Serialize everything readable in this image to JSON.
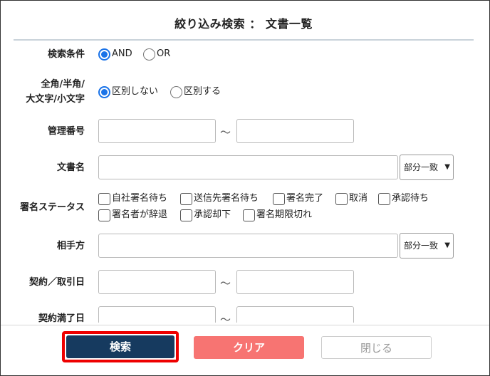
{
  "header": {
    "title": "絞り込み検索 ： 文書一覧"
  },
  "form": {
    "search_condition": {
      "label": "検索条件",
      "options": [
        "AND",
        "OR"
      ],
      "selected": "AND"
    },
    "width_case": {
      "label_line1": "全角/半角/",
      "label_line2": "大文字/小文字",
      "options": [
        "区別しない",
        "区別する"
      ],
      "selected": "区別しない"
    },
    "management_number": {
      "label": "管理番号",
      "separator": "～",
      "from_value": "",
      "to_value": ""
    },
    "document_name": {
      "label": "文書名",
      "value": "",
      "match": "部分一致"
    },
    "signature_status": {
      "label": "署名ステータス",
      "options": [
        "自社署名待ち",
        "送信先署名待ち",
        "署名完了",
        "取消",
        "承認待ち",
        "署名者が辞退",
        "承認却下",
        "署名期限切れ"
      ]
    },
    "counterparty": {
      "label": "相手方",
      "value": "",
      "match": "部分一致"
    },
    "contract_date": {
      "label": "契約／取引日",
      "separator": "～"
    },
    "contract_end_date": {
      "label": "契約満了日",
      "separator": "～"
    }
  },
  "footer": {
    "search_label": "検索",
    "clear_label": "クリア",
    "close_label": "閉じる"
  },
  "colors": {
    "search_button": "#163a5f",
    "clear_button": "#f77472",
    "highlight": "#ee0000",
    "radio_accent": "#1a73e8"
  }
}
